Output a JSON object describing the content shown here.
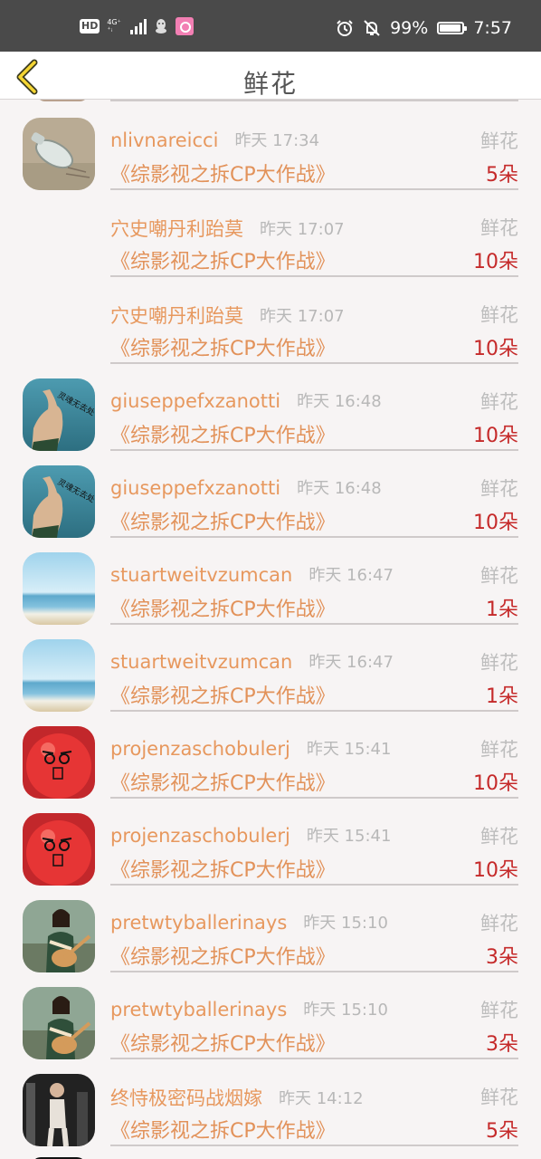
{
  "status_bar": {
    "hd": "HD",
    "network_top": "4G⁺",
    "network_bottom": "⁺ᵢ",
    "battery": "99%",
    "time": "7:57"
  },
  "header": {
    "title": "鲜花"
  },
  "records": [
    {
      "name": "nlivnareicci",
      "time": "昨天 17:34",
      "kind": "鲜花",
      "show": "《综影视之拆CP大作战》",
      "count": "5朵",
      "avatar": "bottle"
    },
    {
      "name": "穴史嘲丹利跆莫",
      "time": "昨天 17:07",
      "kind": "鲜花",
      "show": "《综影视之拆CP大作战》",
      "count": "10朵",
      "avatar": "none"
    },
    {
      "name": "穴史嘲丹利跆莫",
      "time": "昨天 17:07",
      "kind": "鲜花",
      "show": "《综影视之拆CP大作战》",
      "count": "10朵",
      "avatar": "none"
    },
    {
      "name": "giuseppefxzanotti",
      "time": "昨天 16:48",
      "kind": "鲜花",
      "show": "《综影视之拆CP大作战》",
      "count": "10朵",
      "avatar": "hand"
    },
    {
      "name": "giuseppefxzanotti",
      "time": "昨天 16:48",
      "kind": "鲜花",
      "show": "《综影视之拆CP大作战》",
      "count": "10朵",
      "avatar": "hand"
    },
    {
      "name": "stuartweitvzumcan",
      "time": "昨天 16:47",
      "kind": "鲜花",
      "show": "《综影视之拆CP大作战》",
      "count": "1朵",
      "avatar": "sea"
    },
    {
      "name": "stuartweitvzumcan",
      "time": "昨天 16:47",
      "kind": "鲜花",
      "show": "《综影视之拆CP大作战》",
      "count": "1朵",
      "avatar": "sea"
    },
    {
      "name": "projenzaschobulerj",
      "time": "昨天 15:41",
      "kind": "鲜花",
      "show": "《综影视之拆CP大作战》",
      "count": "10朵",
      "avatar": "apple"
    },
    {
      "name": "projenzaschobulerj",
      "time": "昨天 15:41",
      "kind": "鲜花",
      "show": "《综影视之拆CP大作战》",
      "count": "10朵",
      "avatar": "apple"
    },
    {
      "name": "pretwtyballerinays",
      "time": "昨天 15:10",
      "kind": "鲜花",
      "show": "《综影视之拆CP大作战》",
      "count": "3朵",
      "avatar": "guitar"
    },
    {
      "name": "pretwtyballerinays",
      "time": "昨天 15:10",
      "kind": "鲜花",
      "show": "《综影视之拆CP大作战》",
      "count": "3朵",
      "avatar": "guitar"
    },
    {
      "name": "终恃极密码战烟嫁",
      "time": "昨天 14:12",
      "kind": "鲜花",
      "show": "《综影视之拆CP大作战》",
      "count": "5朵",
      "avatar": "gym"
    }
  ],
  "colors": {
    "name": "#e7985e",
    "show": "#e2925a",
    "count": "#c52a2a",
    "kind": "#bdbdbd",
    "time": "#b8b8b8"
  }
}
